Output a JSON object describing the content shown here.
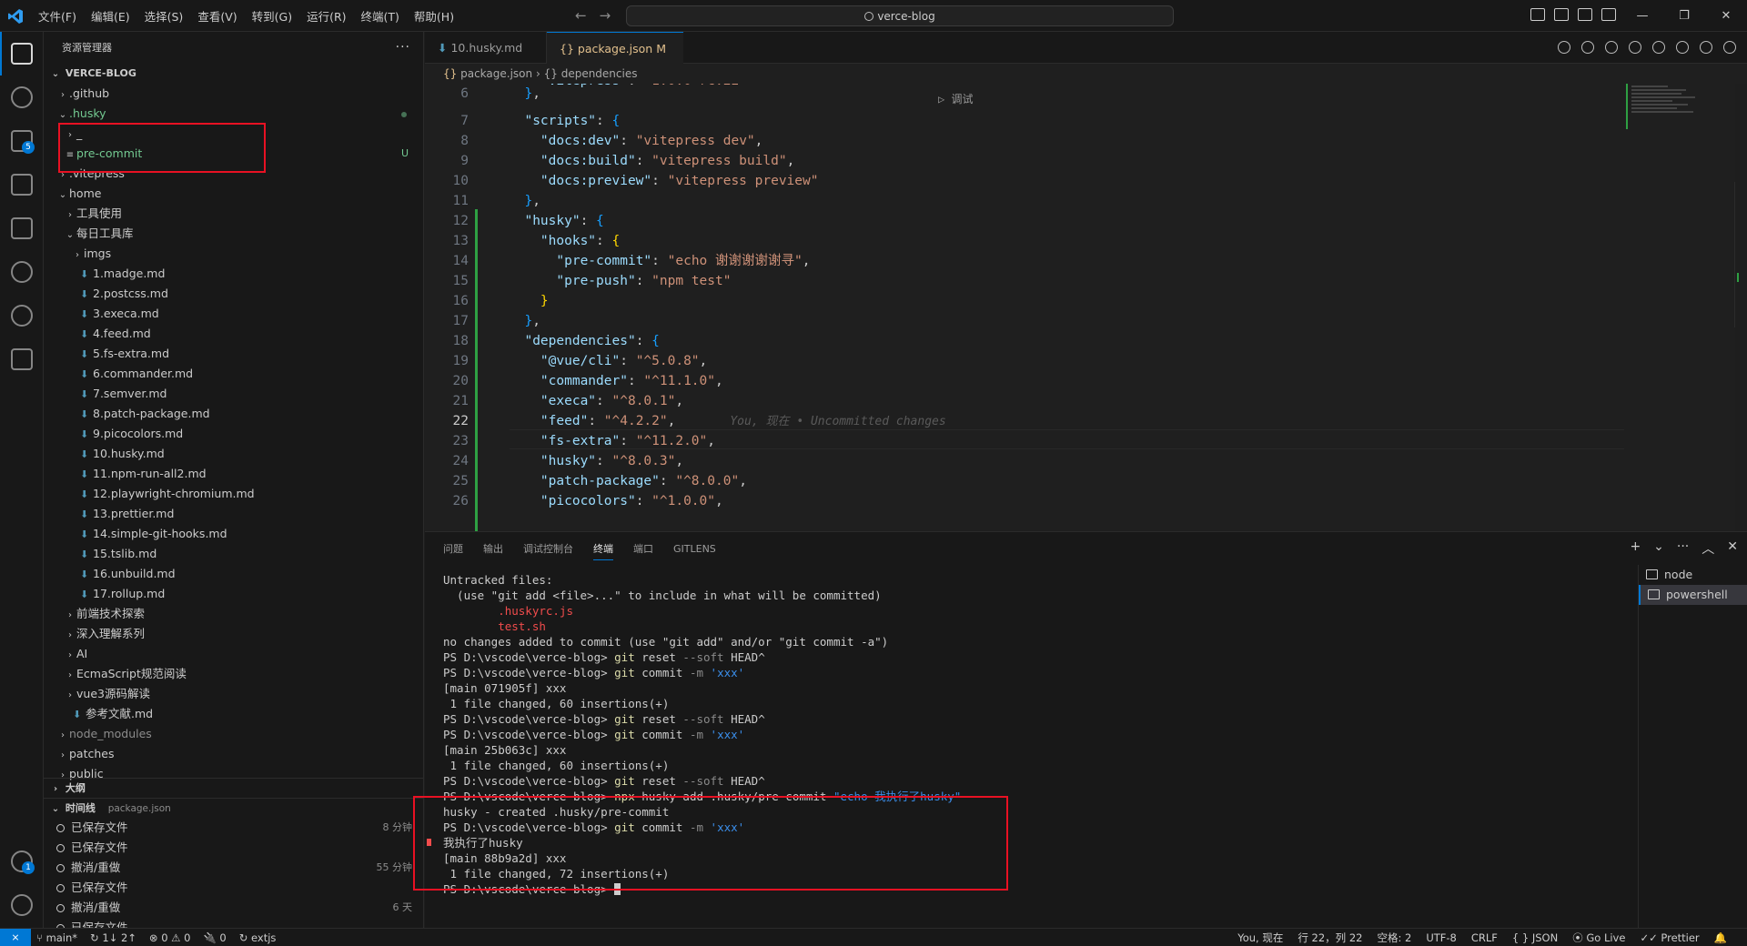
{
  "titlebar": {
    "menu": [
      "文件(F)",
      "编辑(E)",
      "选择(S)",
      "查看(V)",
      "转到(G)",
      "运行(R)",
      "终端(T)",
      "帮助(H)"
    ],
    "search_text": "verce-blog",
    "window_controls": [
      "—",
      "❐",
      "✕"
    ]
  },
  "activity": {
    "source_control_badge": "5",
    "accounts_badge": "1",
    "icons": [
      "explorer-icon",
      "search-icon",
      "source-control-icon",
      "run-debug-icon",
      "extensions-icon",
      "git-graph-icon",
      "gitlens-icon",
      "remote-explorer-icon"
    ]
  },
  "sidebar": {
    "title": "资源管理器",
    "more": "···",
    "root": "VERCE-BLOG",
    "tree": [
      {
        "label": ".github",
        "indent": 1,
        "kind": "folder-closed"
      },
      {
        "label": ".husky",
        "indent": 1,
        "kind": "folder-open",
        "green": true,
        "dot": true
      },
      {
        "label": "_",
        "indent": 2,
        "kind": "folder-closed"
      },
      {
        "label": "pre-commit",
        "indent": 2,
        "kind": "file",
        "green": true,
        "status": "U"
      },
      {
        "label": ".vitepress",
        "indent": 1,
        "kind": "folder-closed"
      },
      {
        "label": "home",
        "indent": 1,
        "kind": "folder-open"
      },
      {
        "label": "工具使用",
        "indent": 2,
        "kind": "folder-closed"
      },
      {
        "label": "每日工具库",
        "indent": 2,
        "kind": "folder-open"
      },
      {
        "label": "imgs",
        "indent": 3,
        "kind": "folder-closed"
      },
      {
        "label": "1.madge.md",
        "indent": 3,
        "kind": "md"
      },
      {
        "label": "2.postcss.md",
        "indent": 3,
        "kind": "md"
      },
      {
        "label": "3.execa.md",
        "indent": 3,
        "kind": "md"
      },
      {
        "label": "4.feed.md",
        "indent": 3,
        "kind": "md"
      },
      {
        "label": "5.fs-extra.md",
        "indent": 3,
        "kind": "md"
      },
      {
        "label": "6.commander.md",
        "indent": 3,
        "kind": "md"
      },
      {
        "label": "7.semver.md",
        "indent": 3,
        "kind": "md"
      },
      {
        "label": "8.patch-package.md",
        "indent": 3,
        "kind": "md"
      },
      {
        "label": "9.picocolors.md",
        "indent": 3,
        "kind": "md"
      },
      {
        "label": "10.husky.md",
        "indent": 3,
        "kind": "md"
      },
      {
        "label": "11.npm-run-all2.md",
        "indent": 3,
        "kind": "md"
      },
      {
        "label": "12.playwright-chromium.md",
        "indent": 3,
        "kind": "md"
      },
      {
        "label": "13.prettier.md",
        "indent": 3,
        "kind": "md"
      },
      {
        "label": "14.simple-git-hooks.md",
        "indent": 3,
        "kind": "md"
      },
      {
        "label": "15.tslib.md",
        "indent": 3,
        "kind": "md"
      },
      {
        "label": "16.unbuild.md",
        "indent": 3,
        "kind": "md"
      },
      {
        "label": "17.rollup.md",
        "indent": 3,
        "kind": "md"
      },
      {
        "label": "前端技术探索",
        "indent": 2,
        "kind": "folder-closed"
      },
      {
        "label": "深入理解系列",
        "indent": 2,
        "kind": "folder-closed"
      },
      {
        "label": "AI",
        "indent": 2,
        "kind": "folder-closed"
      },
      {
        "label": "EcmaScript规范阅读",
        "indent": 2,
        "kind": "folder-closed"
      },
      {
        "label": "vue3源码解读",
        "indent": 2,
        "kind": "folder-closed"
      },
      {
        "label": "参考文献.md",
        "indent": 2,
        "kind": "md"
      },
      {
        "label": "node_modules",
        "indent": 1,
        "kind": "folder-closed",
        "dim": true
      },
      {
        "label": "patches",
        "indent": 1,
        "kind": "folder-closed"
      },
      {
        "label": "public",
        "indent": 1,
        "kind": "folder-closed"
      }
    ],
    "outline_title": "大纲",
    "timeline_title": "时间线",
    "timeline_file": "package.json",
    "timeline": [
      {
        "label": "已保存文件",
        "time": "8 分钟"
      },
      {
        "label": "已保存文件",
        "time": ""
      },
      {
        "label": "撤消/重做",
        "time": "55 分钟"
      },
      {
        "label": "已保存文件",
        "time": ""
      },
      {
        "label": "撤消/重做",
        "time": "6 天"
      },
      {
        "label": "已保存文件",
        "time": ""
      }
    ]
  },
  "tabs": [
    {
      "label": "10.husky.md",
      "active": false
    },
    {
      "label": "package.json",
      "modified": "M",
      "active": true,
      "close": "✕"
    }
  ],
  "breadcrumb": {
    "file": "package.json",
    "sep": "›",
    "node": "dependencies"
  },
  "editor": {
    "codelens": "▷ 调试",
    "blame": "You, 现在 • Uncommitted changes",
    "lines": [
      {
        "n": "6",
        "html": "  <span class='b2'>}</span><span class='p'>,</span>"
      },
      {
        "n": "7",
        "html": "  <span class='k'>\"scripts\"</span><span class='p'>: </span><span class='b2'>{</span>"
      },
      {
        "n": "8",
        "html": "    <span class='k'>\"docs:dev\"</span><span class='p'>: </span><span class='s'>\"vitepress dev\"</span><span class='p'>,</span>"
      },
      {
        "n": "9",
        "html": "    <span class='k'>\"docs:build\"</span><span class='p'>: </span><span class='s'>\"vitepress build\"</span><span class='p'>,</span>"
      },
      {
        "n": "10",
        "html": "    <span class='k'>\"docs:preview\"</span><span class='p'>: </span><span class='s'>\"vitepress preview\"</span>"
      },
      {
        "n": "11",
        "html": "  <span class='b2'>}</span><span class='p'>,</span>"
      },
      {
        "n": "12",
        "html": "  <span class='k'>\"husky\"</span><span class='p'>: </span><span class='b2'>{</span>"
      },
      {
        "n": "13",
        "html": "    <span class='k'>\"hooks\"</span><span class='p'>: </span><span class='b3'>{</span>"
      },
      {
        "n": "14",
        "html": "      <span class='k'>\"pre-commit\"</span><span class='p'>: </span><span class='s'>\"echo 谢谢谢谢谢寻\"</span><span class='p'>,</span>"
      },
      {
        "n": "15",
        "html": "      <span class='k'>\"pre-push\"</span><span class='p'>: </span><span class='s'>\"npm test\"</span>"
      },
      {
        "n": "16",
        "html": "    <span class='b3'>}</span>"
      },
      {
        "n": "17",
        "html": "  <span class='b2'>}</span><span class='p'>,</span>"
      },
      {
        "n": "18",
        "html": "  <span class='k'>\"dependencies\"</span><span class='p'>: </span><span class='b2'>{</span>"
      },
      {
        "n": "19",
        "html": "    <span class='k'>\"@vue/cli\"</span><span class='p'>: </span><span class='s'>\"^5.0.8\"</span><span class='p'>,</span>"
      },
      {
        "n": "20",
        "html": "    <span class='k'>\"commander\"</span><span class='p'>: </span><span class='s'>\"^11.1.0\"</span><span class='p'>,</span>"
      },
      {
        "n": "21",
        "html": "    <span class='k'>\"execa\"</span><span class='p'>: </span><span class='s'>\"^8.0.1\"</span><span class='p'>,</span>"
      },
      {
        "n": "22",
        "html": "    <span class='k'>\"feed\"</span><span class='p'>: </span><span class='s'>\"^4.2.2\"</span><span class='p'>,</span>",
        "current": true
      },
      {
        "n": "23",
        "html": "    <span class='k'>\"fs-extra\"</span><span class='p'>: </span><span class='s'>\"^11.2.0\"</span><span class='p'>,</span>"
      },
      {
        "n": "24",
        "html": "    <span class='k'>\"husky\"</span><span class='p'>: </span><span class='s'>\"^8.0.3\"</span><span class='p'>,</span>"
      },
      {
        "n": "25",
        "html": "    <span class='k'>\"patch-package\"</span><span class='p'>: </span><span class='s'>\"^8.0.0\"</span><span class='p'>,</span>"
      },
      {
        "n": "26",
        "html": "    <span class='k'>\"picocolors\"</span><span class='p'>: </span><span class='s'>\"^1.0.0\"</span><span class='p'>,</span>"
      }
    ]
  },
  "panel": {
    "tabs": [
      "问题",
      "输出",
      "调试控制台",
      "终端",
      "端口",
      "GITLENS"
    ],
    "active_tab": "终端",
    "actions": [
      "+",
      "⌄",
      "···",
      "︿",
      "✕"
    ],
    "terminals": [
      "node",
      "powershell"
    ],
    "selected_terminal": "powershell",
    "output": [
      {
        "t": "plain",
        "text": "Untracked files:"
      },
      {
        "t": "plain",
        "text": "  (use \"git add <file>...\" to include in what will be committed)"
      },
      {
        "t": "red",
        "text": "        .huskyrc.js"
      },
      {
        "t": "red",
        "text": "        test.sh"
      },
      {
        "t": "plain",
        "text": ""
      },
      {
        "t": "plain",
        "text": "no changes added to commit (use \"git add\" and/or \"git commit -a\")"
      },
      {
        "t": "ps",
        "prompt": "PS D:\\vscode\\verce-blog> ",
        "cmd": "git",
        "args": " reset ",
        "gray": "--soft",
        "rest": " HEAD^"
      },
      {
        "t": "ps",
        "prompt": "PS D:\\vscode\\verce-blog> ",
        "cmd": "git",
        "args": " commit ",
        "gray": "-m",
        "rest": " ",
        "str": "'xxx'"
      },
      {
        "t": "plain",
        "text": "[main 071905f] xxx"
      },
      {
        "t": "plain",
        "text": " 1 file changed, 60 insertions(+)"
      },
      {
        "t": "ps",
        "prompt": "PS D:\\vscode\\verce-blog> ",
        "cmd": "git",
        "args": " reset ",
        "gray": "--soft",
        "rest": " HEAD^"
      },
      {
        "t": "ps",
        "prompt": "PS D:\\vscode\\verce-blog> ",
        "cmd": "git",
        "args": " commit ",
        "gray": "-m",
        "rest": " ",
        "str": "'xxx'"
      },
      {
        "t": "plain",
        "text": "[main 25b063c] xxx"
      },
      {
        "t": "plain",
        "text": " 1 file changed, 60 insertions(+)"
      },
      {
        "t": "ps",
        "prompt": "PS D:\\vscode\\verce-blog> ",
        "cmd": "git",
        "args": " reset ",
        "gray": "--soft",
        "rest": " HEAD^"
      },
      {
        "t": "ps",
        "prompt": "PS D:\\vscode\\verce-blog> ",
        "cmd": "npx",
        "args": " husky add .husky/pre-commit ",
        "gray": "",
        "rest": "",
        "str": "\"echo 我执行了husky\""
      },
      {
        "t": "plain",
        "text": "husky - created .husky/pre-commit"
      },
      {
        "t": "ps",
        "prompt": "PS D:\\vscode\\verce-blog> ",
        "cmd": "git",
        "args": " commit ",
        "gray": "-m",
        "rest": " ",
        "str": "'xxx'"
      },
      {
        "t": "plain",
        "text": "我执行了husky"
      },
      {
        "t": "plain",
        "text": "[main 88b9a2d] xxx"
      },
      {
        "t": "plain",
        "text": " 1 file changed, 72 insertions(+)"
      },
      {
        "t": "prompt-end",
        "text": "PS D:\\vscode\\verce-blog> "
      }
    ]
  },
  "statusbar": {
    "remote": "⨯",
    "branch": "main*",
    "sync": "↻ 1↓ 2↑",
    "errors": "⊗ 0 ⚠ 0",
    "ports": "🔌 0",
    "ext": "↻ extjs",
    "blame": "You, 现在",
    "position": "行 22，列 22",
    "spaces": "空格: 2",
    "encoding": "UTF-8",
    "eol": "CRLF",
    "language": "{ } JSON",
    "golive": "Go Live",
    "prettier": "✓✓ Prettier",
    "bell": "🔔"
  }
}
